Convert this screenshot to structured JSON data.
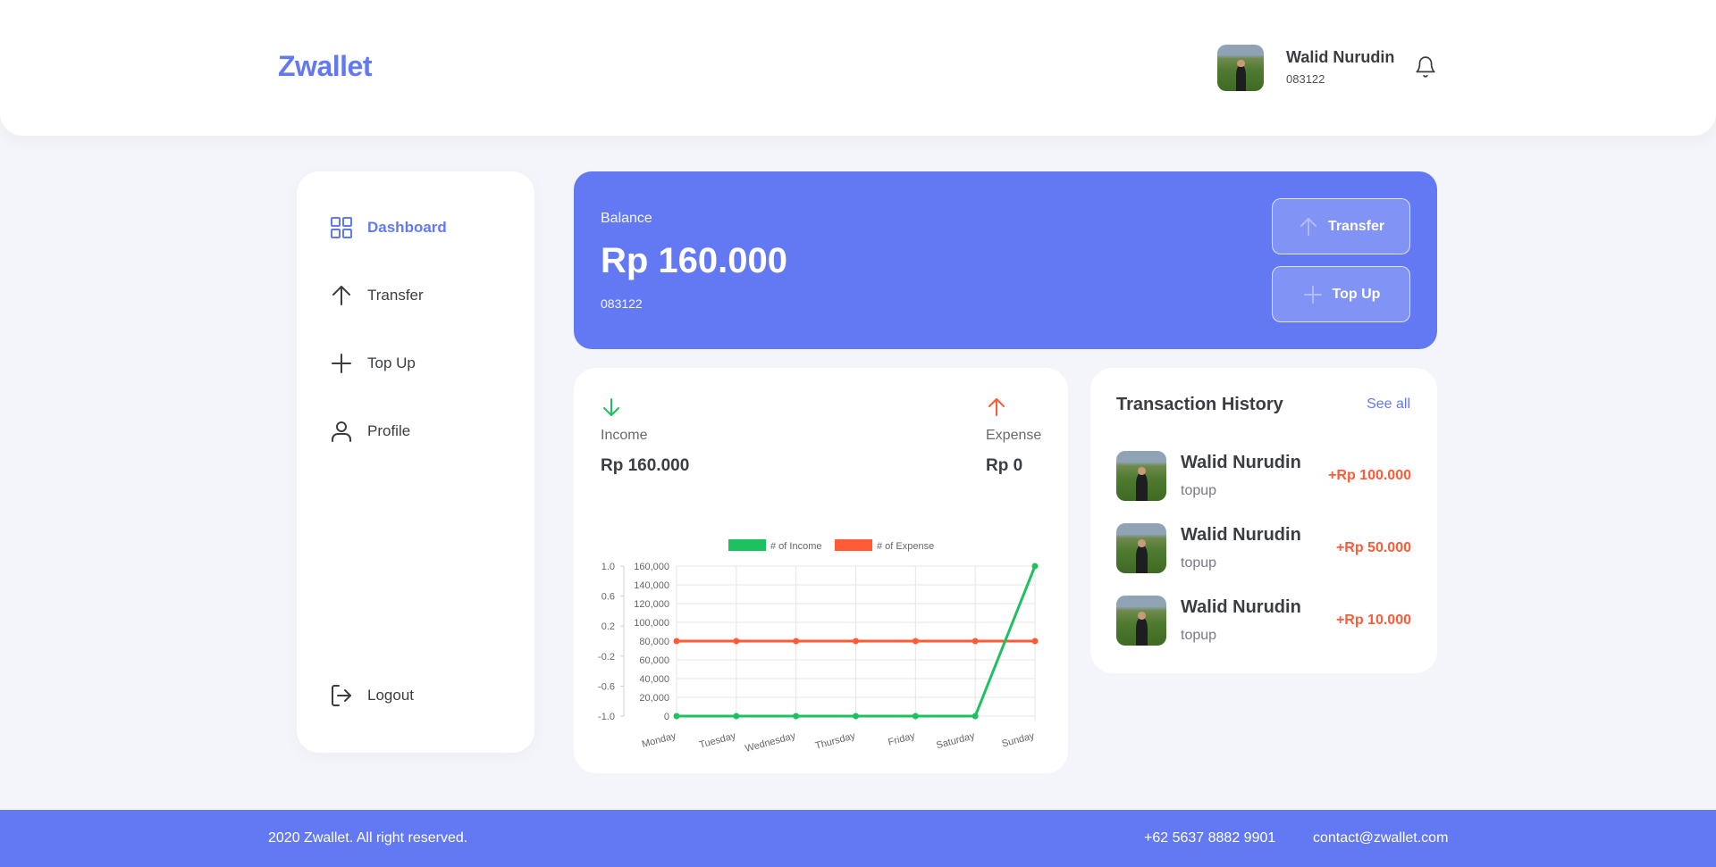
{
  "app": {
    "logo": "Zwallet"
  },
  "header": {
    "user_name": "Walid Nurudin",
    "user_phone": "083122",
    "bell_icon": "bell-icon"
  },
  "sidebar": {
    "items": [
      {
        "label": "Dashboard",
        "icon": "grid-icon",
        "active": true
      },
      {
        "label": "Transfer",
        "icon": "arrow-up-icon",
        "active": false
      },
      {
        "label": "Top Up",
        "icon": "plus-icon",
        "active": false
      },
      {
        "label": "Profile",
        "icon": "user-icon",
        "active": false
      }
    ],
    "logout_label": "Logout"
  },
  "balance": {
    "label": "Balance",
    "amount": "Rp 160.000",
    "phone": "083122",
    "transfer_label": "Transfer",
    "topup_label": "Top Up"
  },
  "summary": {
    "income_label": "Income",
    "income_value": "Rp 160.000",
    "expense_label": "Expense",
    "expense_value": "Rp 0"
  },
  "chart_data": {
    "type": "line",
    "categories": [
      "Monday",
      "Tuesday",
      "Wednesday",
      "Thursday",
      "Friday",
      "Saturday",
      "Sunday"
    ],
    "series": [
      {
        "name": "# of Income",
        "color": "#1ec15f",
        "values": [
          0,
          0,
          0,
          0,
          0,
          0,
          160000
        ]
      },
      {
        "name": "# of Expense",
        "color": "#ff5b37",
        "values": [
          0,
          0,
          0,
          0,
          0,
          0,
          0
        ]
      }
    ],
    "y_left": {
      "ticks": [
        "1.0",
        "0.6",
        "0.2",
        "-0.2",
        "-0.6",
        "-1.0"
      ],
      "range": [
        -1.0,
        1.0
      ]
    },
    "y_right": {
      "ticks": [
        "160,000",
        "140,000",
        "120,000",
        "100,000",
        "80,000",
        "60,000",
        "40,000",
        "20,000",
        "0"
      ],
      "range": [
        0,
        160000
      ]
    },
    "legend_position": "top",
    "grid": true
  },
  "history": {
    "title": "Transaction History",
    "see_all": "See all",
    "items": [
      {
        "name": "Walid Nurudin",
        "type": "topup",
        "amount": "+Rp 100.000"
      },
      {
        "name": "Walid Nurudin",
        "type": "topup",
        "amount": "+Rp 50.000"
      },
      {
        "name": "Walid Nurudin",
        "type": "topup",
        "amount": "+Rp 10.000"
      }
    ]
  },
  "footer": {
    "copyright": "2020 Zwallet. All right reserved.",
    "phone": "+62 5637 8882 9901",
    "email": "contact@zwallet.com"
  },
  "colors": {
    "primary": "#6379f4",
    "income": "#1ec15f",
    "expense": "#ff5b37"
  }
}
